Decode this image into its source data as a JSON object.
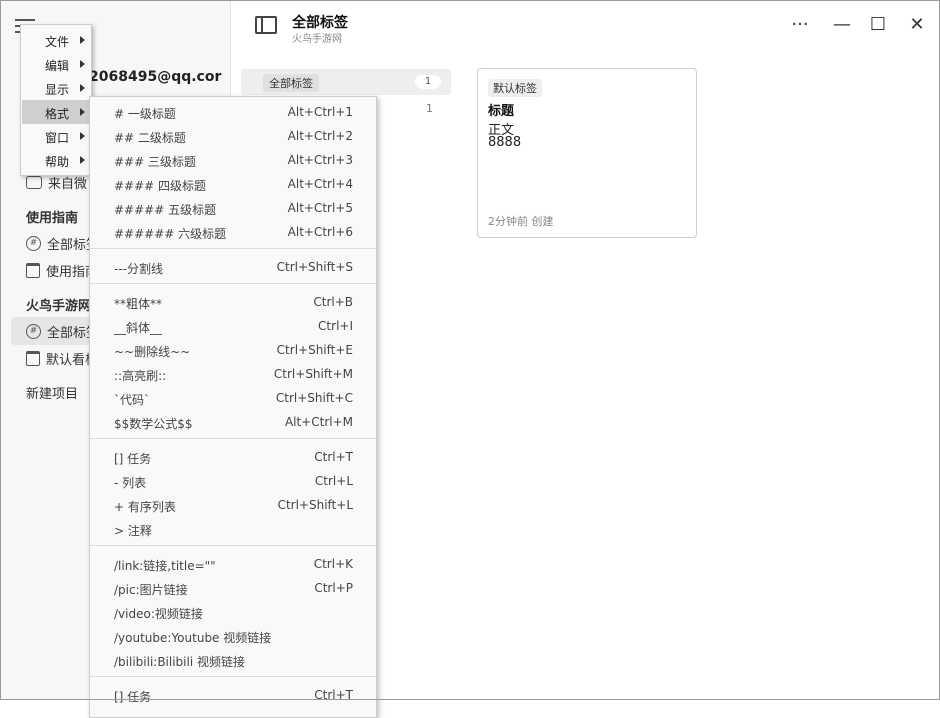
{
  "sidebar": {
    "account": "2068495@qq.cor",
    "row_feed": "来自微",
    "heading_guide": "使用指南",
    "guide_all_tags": "全部标签",
    "guide_usage": "使用指南",
    "heading_project": "火鸟手游网",
    "project_all_tags": "全部标签",
    "project_default": "默认看板",
    "new_project": "新建项目"
  },
  "header": {
    "title": "全部标签",
    "subtitle": "火鸟手游网",
    "more": "···",
    "minimize": "—",
    "maximize": "☐",
    "close": "✕"
  },
  "tags": {
    "all_label": "全部标签",
    "all_count": "1",
    "second_count": "1"
  },
  "card": {
    "tag": "默认标签",
    "title": "标题",
    "line1": "正文",
    "line2": "8888",
    "meta": "2分钟前 创建"
  },
  "menu": {
    "items": [
      {
        "label": "文件"
      },
      {
        "label": "编辑"
      },
      {
        "label": "显示"
      },
      {
        "label": "格式"
      },
      {
        "label": "窗口"
      },
      {
        "label": "帮助"
      }
    ]
  },
  "format_menu": {
    "items": [
      {
        "label": "# 一级标题",
        "shortcut": "Alt+Ctrl+1"
      },
      {
        "label": "## 二级标题",
        "shortcut": "Alt+Ctrl+2"
      },
      {
        "label": "### 三级标题",
        "shortcut": "Alt+Ctrl+3"
      },
      {
        "label": "#### 四级标题",
        "shortcut": "Alt+Ctrl+4"
      },
      {
        "label": "##### 五级标题",
        "shortcut": "Alt+Ctrl+5"
      },
      {
        "label": "###### 六级标题",
        "shortcut": "Alt+Ctrl+6"
      },
      {
        "label": "---分割线",
        "shortcut": "Ctrl+Shift+S"
      },
      {
        "label": "**粗体**",
        "shortcut": "Ctrl+B"
      },
      {
        "label": "__斜体__",
        "shortcut": "Ctrl+I"
      },
      {
        "label": "~~删除线~~",
        "shortcut": "Ctrl+Shift+E"
      },
      {
        "label": "::高亮刷::",
        "shortcut": "Ctrl+Shift+M"
      },
      {
        "label": "`代码`",
        "shortcut": "Ctrl+Shift+C"
      },
      {
        "label": "$$数学公式$$",
        "shortcut": "Alt+Ctrl+M"
      },
      {
        "label": "[] 任务",
        "shortcut": "Ctrl+T"
      },
      {
        "label": "- 列表",
        "shortcut": "Ctrl+L"
      },
      {
        "label": "+ 有序列表",
        "shortcut": "Ctrl+Shift+L"
      },
      {
        "label": "> 注释",
        "shortcut": ""
      },
      {
        "label": "/link:链接,title=\"\"",
        "shortcut": "Ctrl+K"
      },
      {
        "label": "/pic:图片链接",
        "shortcut": "Ctrl+P"
      },
      {
        "label": "/video:视频链接",
        "shortcut": ""
      },
      {
        "label": "/youtube:Youtube 视频链接",
        "shortcut": ""
      },
      {
        "label": "/bilibili:Bilibili 视频链接",
        "shortcut": ""
      },
      {
        "label": "[] 任务",
        "shortcut": "Ctrl+T"
      }
    ]
  }
}
